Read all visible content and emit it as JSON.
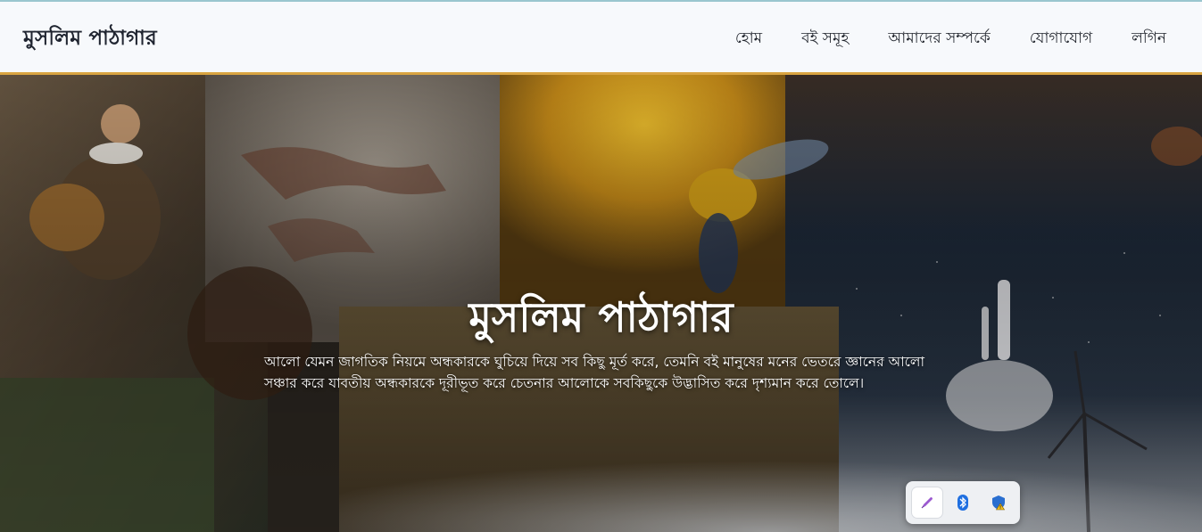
{
  "navbar": {
    "brand": "মুসলিম পাঠাগার",
    "links": [
      "হোম",
      "বই সমূহ",
      "আমাদের সম্পর্কে",
      "যোগাযোগ",
      "লগিন"
    ]
  },
  "hero": {
    "title": "মুসলিম পাঠাগার",
    "subtitle": "আলো যেমন জাগতিক নিয়মে অন্ধকারকে ঘুচিয়ে দিয়ে সব কিছু মূর্ত করে, তেমনি বই মানুষের মনের ভেতরে জ্ঞানের আলো সঞ্চার করে যাবতীয় অন্ধকারকে দূরীভূত করে চেতনার আলোকে সবকিছুকে উদ্ভাসিত করে দৃশ্যমান করে তোলে।"
  },
  "tray": {
    "icons": [
      "pen-icon",
      "bluetooth-icon",
      "security-warning-icon"
    ]
  },
  "colors": {
    "navbar_bg": "#f7f9fc",
    "navbar_border": "#d9a441",
    "brand_text": "#1f2430"
  }
}
